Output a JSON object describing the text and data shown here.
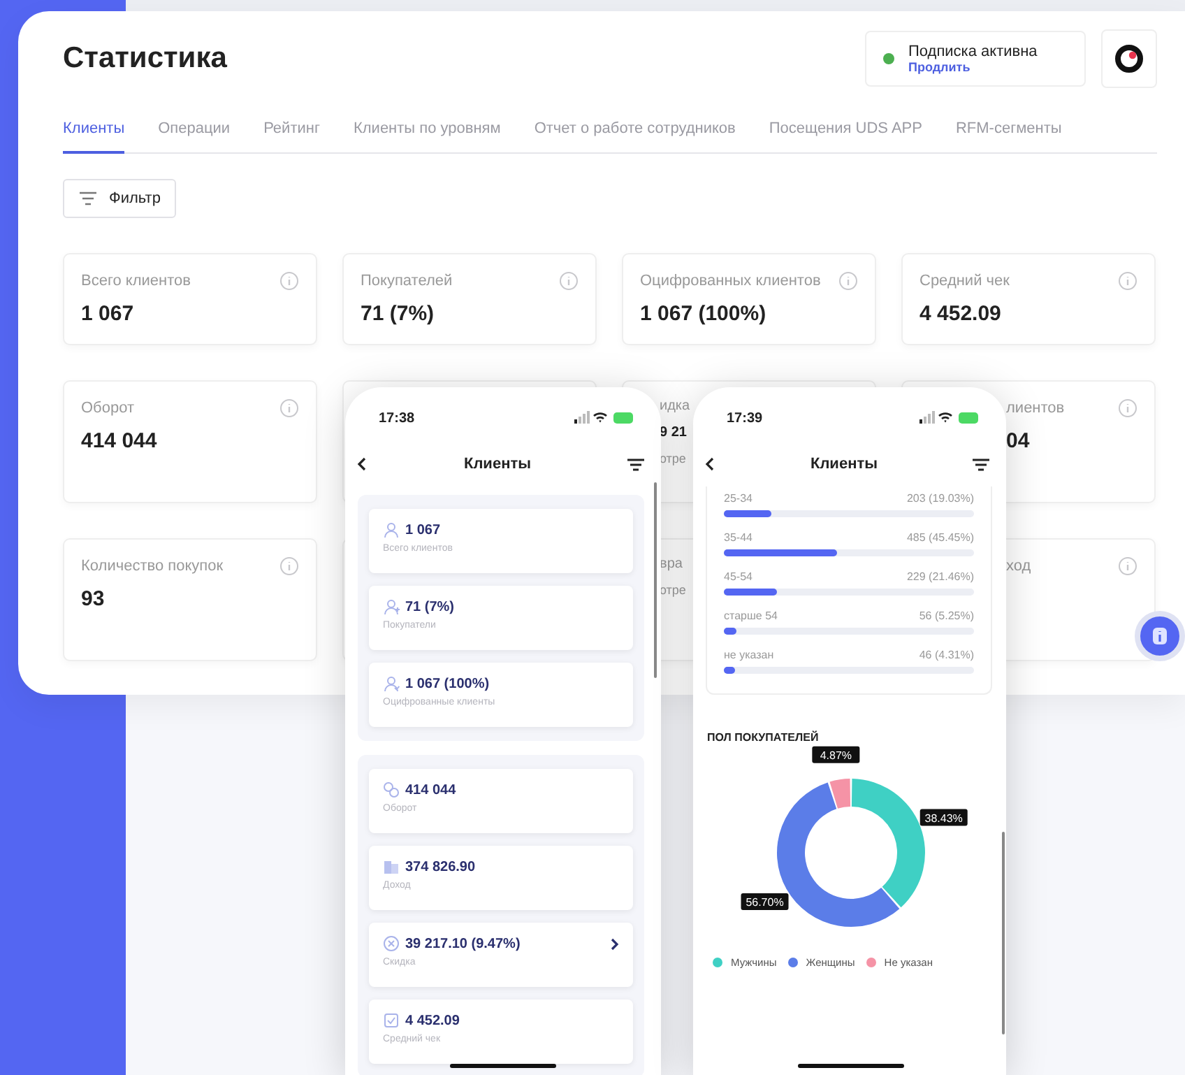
{
  "page": {
    "title": "Статистика"
  },
  "subscription": {
    "status": "Подписка активна",
    "link": "Продлить",
    "active": true
  },
  "tabs": [
    {
      "label": "Клиенты",
      "selected": true
    },
    {
      "label": "Операции",
      "selected": false
    },
    {
      "label": "Рейтинг",
      "selected": false
    },
    {
      "label": "Клиенты по уровням",
      "selected": false
    },
    {
      "label": "Отчет о работе сотрудников",
      "selected": false
    },
    {
      "label": "Посещения UDS APP",
      "selected": false
    },
    {
      "label": "RFM-сегменты",
      "selected": false
    }
  ],
  "filter_button": "Фильтр",
  "stat_rows": [
    {
      "cards": [
        {
          "kind": "full",
          "label": "Всего клиентов",
          "value": "1 067"
        },
        {
          "kind": "full",
          "label": "Покупателей",
          "value": "71 (7%)"
        },
        {
          "kind": "full",
          "label": "Оцифрованных клиентов",
          "value": "1 067 (100%)"
        },
        {
          "kind": "full",
          "label": "Средний чек",
          "value": "4 452.09"
        }
      ]
    },
    {
      "cards": [
        {
          "kind": "full",
          "label": "Оборот",
          "value": "414 044"
        },
        {
          "kind": "covered"
        },
        {
          "kind": "partial",
          "label": "идка",
          "value": "9 21",
          "note": "отре"
        },
        {
          "kind": "partial",
          "label": "лиентов",
          "value": "04"
        }
      ]
    },
    {
      "cards": [
        {
          "kind": "full",
          "label": "Количество покупок",
          "value": "93"
        },
        {
          "kind": "covered"
        },
        {
          "kind": "partial",
          "label": "вра",
          "note": "отре"
        },
        {
          "kind": "partial",
          "label": "ход"
        }
      ]
    }
  ],
  "phone_left": {
    "time": "17:38",
    "title": "Клиенты",
    "groups": [
      {
        "items": [
          {
            "kind": "person",
            "value": "1 067",
            "label": "Всего клиентов",
            "expandable": false
          },
          {
            "kind": "person-plus",
            "value": "71 (7%)",
            "label": "Покупатели",
            "expandable": false
          },
          {
            "kind": "person-check",
            "value": "1 067 (100%)",
            "label": "Оцифрованные клиенты",
            "expandable": false
          }
        ]
      },
      {
        "items": [
          {
            "kind": "coins",
            "value": "414 044",
            "label": "Оборот",
            "expandable": false
          },
          {
            "kind": "stack",
            "value": "374 826.90",
            "label": "Доход",
            "expandable": false
          },
          {
            "kind": "discount",
            "value": "39 217.10 (9.47%)",
            "label": "Скидка",
            "expandable": true
          },
          {
            "kind": "receipt",
            "value": "4 452.09",
            "label": "Средний чек",
            "expandable": false
          }
        ]
      }
    ]
  },
  "phone_right": {
    "time": "17:39",
    "title": "Клиенты",
    "age_groups": [
      {
        "label": "25-34",
        "reading": "203 (19.03%)",
        "level": 0.1903
      },
      {
        "label": "35-44",
        "reading": "485 (45.45%)",
        "level": 0.4545
      },
      {
        "label": "45-54",
        "reading": "229 (21.46%)",
        "level": 0.2146
      },
      {
        "label": "старше 54",
        "reading": "56 (5.25%)",
        "level": 0.0525
      },
      {
        "label": "не указан",
        "reading": "46 (4.31%)",
        "level": 0.0431
      }
    ],
    "gender_title": "ПОЛ ПОКУПАТЕЛЕЙ",
    "chart_data": {
      "type": "donut",
      "categories": [
        "Мужчины",
        "Женщины",
        "Не указан"
      ],
      "values": [
        38.43,
        56.7,
        4.87
      ],
      "data_labels": true,
      "value_labels": [
        "38.43%",
        "56.70%",
        "4.87%"
      ]
    },
    "legend": [
      {
        "color": "#3fd0c4"
      },
      {
        "color": "#5b7de8"
      },
      {
        "color": "#f593a6"
      }
    ]
  }
}
